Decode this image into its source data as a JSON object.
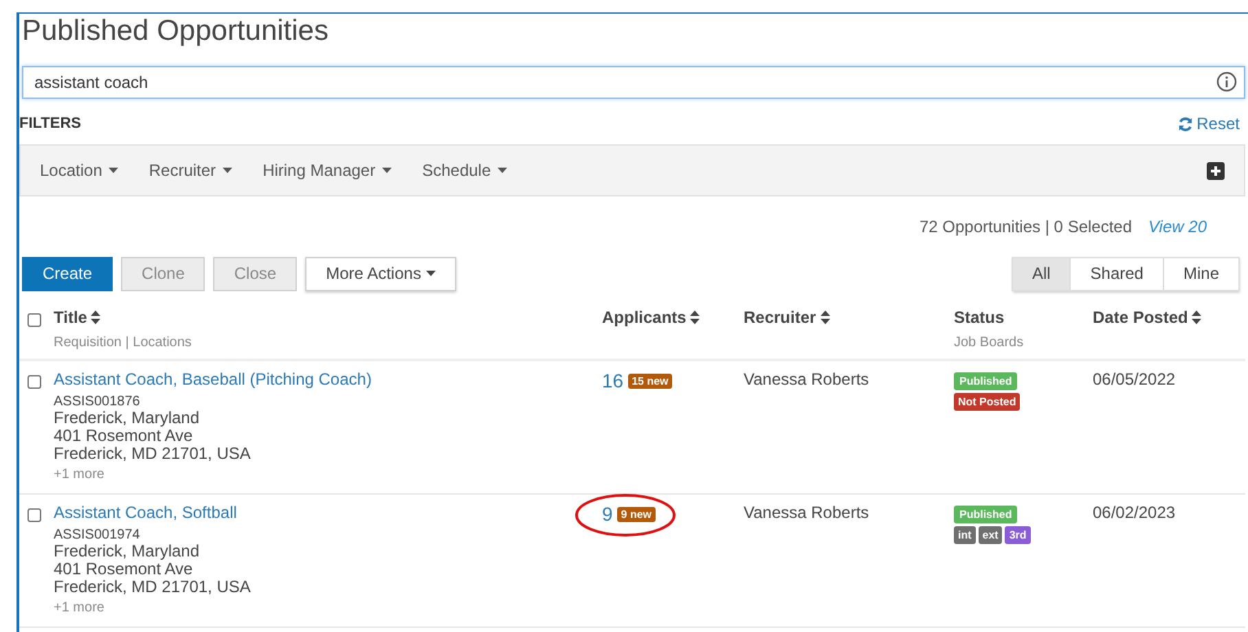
{
  "page_title": "Published Opportunities",
  "search": {
    "value": "assistant coach"
  },
  "filters": {
    "label": "FILTERS",
    "reset": "Reset",
    "items": [
      "Location",
      "Recruiter",
      "Hiring Manager",
      "Schedule"
    ]
  },
  "summary": {
    "count": "72 Opportunities | 0 Selected",
    "view": "View 20"
  },
  "actions": [
    {
      "label": "Create",
      "kind": "primary"
    },
    {
      "label": "Clone",
      "kind": "disabled"
    },
    {
      "label": "Close",
      "kind": "disabled"
    },
    {
      "label": "More Actions",
      "kind": "dropdown"
    }
  ],
  "scope_tabs": [
    {
      "label": "All",
      "selected": true
    },
    {
      "label": "Shared",
      "selected": false
    },
    {
      "label": "Mine",
      "selected": false
    }
  ],
  "table": {
    "select_all_checked": false,
    "columns": [
      {
        "label": "Title",
        "sub": "Requisition | Locations",
        "sortable": true
      },
      {
        "label": "Applicants",
        "sortable": true
      },
      {
        "label": "Recruiter",
        "sortable": true
      },
      {
        "label": "Status",
        "sub": "Job Boards",
        "sortable": false
      },
      {
        "label": "Date Posted",
        "sortable": true
      }
    ],
    "rows": [
      {
        "checked": false,
        "title": "Assistant Coach, Baseball (Pitching Coach)",
        "requisition": "ASSIS001876",
        "location": [
          "Frederick, Maryland",
          "401 Rosemont Ave",
          "Frederick, MD 21701, USA"
        ],
        "more": "+1 more",
        "applicants": "16",
        "new_badge": "15 new",
        "circled": false,
        "recruiter": "Vanessa Roberts",
        "status": "Published",
        "boards": [
          {
            "label": "Not Posted",
            "color": "#c0392b"
          }
        ],
        "date": "06/05/2022"
      },
      {
        "checked": false,
        "title": "Assistant Coach, Softball",
        "requisition": "ASSIS001974",
        "location": [
          "Frederick, Maryland",
          "401 Rosemont Ave",
          "Frederick, MD 21701, USA"
        ],
        "more": "+1 more",
        "applicants": "9",
        "new_badge": "9 new",
        "circled": true,
        "recruiter": "Vanessa Roberts",
        "status": "Published",
        "boards": [
          {
            "label": "int",
            "color": "#6f6f6f"
          },
          {
            "label": "ext",
            "color": "#6f6f6f"
          },
          {
            "label": "3rd",
            "color": "#8a5cd6"
          }
        ],
        "date": "06/02/2023"
      }
    ]
  }
}
